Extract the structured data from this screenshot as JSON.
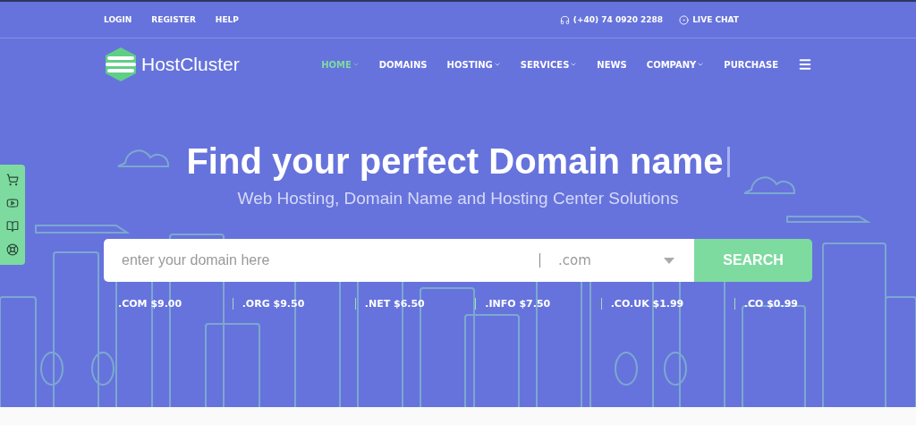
{
  "top_bar": {
    "links": [
      "LOGIN",
      "REGISTER",
      "HELP"
    ],
    "phone": "(+40) 74 0920 2288",
    "live_chat": "LIVE CHAT"
  },
  "header": {
    "logo": "HostCluster",
    "nav": [
      {
        "label": "HOME",
        "selected": true,
        "dropdown": true
      },
      {
        "label": "DOMAINS",
        "selected": false,
        "dropdown": false
      },
      {
        "label": "HOSTING",
        "selected": false,
        "dropdown": true
      },
      {
        "label": "SERVICES",
        "selected": false,
        "dropdown": true
      },
      {
        "label": "NEWS",
        "selected": false,
        "dropdown": false
      },
      {
        "label": "COMPANY",
        "selected": false,
        "dropdown": true
      },
      {
        "label": "PURCHASE",
        "selected": false,
        "dropdown": false
      }
    ]
  },
  "side_toolbar": [
    {
      "kind": "cart"
    },
    {
      "kind": "video"
    },
    {
      "kind": "book"
    },
    {
      "kind": "support"
    }
  ],
  "hero": {
    "title": "Find your perfect Domain name",
    "subtitle": "Web Hosting, Domain Name and Hosting Center Solutions",
    "search": {
      "placeholder": "enter your domain here",
      "extension": ".com",
      "button": "SEARCH"
    },
    "prices": [
      ".COM $9.00",
      ".ORG $9.50",
      ".NET $6.50",
      ".INFO $7.50",
      ".CO.UK $1.99",
      ".CO $0.99"
    ]
  }
}
